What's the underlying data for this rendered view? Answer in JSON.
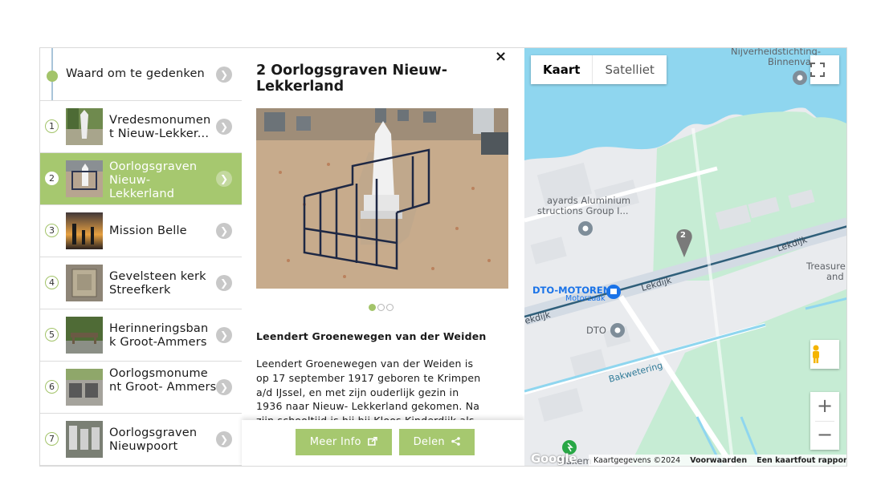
{
  "sidebar": {
    "header_label": "Waard om te gedenken",
    "items": [
      {
        "number": "1",
        "label": "Vredesmonumen t Nieuw-Lekker..."
      },
      {
        "number": "2",
        "label": "Oorlogsgraven Nieuw- Lekkerland"
      },
      {
        "number": "3",
        "label": "Mission Belle"
      },
      {
        "number": "4",
        "label": "Gevelsteen kerk Streefkerk"
      },
      {
        "number": "5",
        "label": "Herinneringsban k Groot-Ammers"
      },
      {
        "number": "6",
        "label": "Oorlogsmonume nt Groot- Ammers"
      },
      {
        "number": "7",
        "label": "Oorlogsgraven Nieuwpoort"
      }
    ],
    "chevron_icon": "chevron-right-icon"
  },
  "detail": {
    "close": "×",
    "title": "2 Oorlogsgraven Nieuw-Lekkerland",
    "carousel": {
      "total": 3,
      "active": 1
    },
    "subheading": "Leendert Groenewegen van der Weiden",
    "body": "Leendert Groenewegen van der Weiden is op 17 september 1917 geboren te Krimpen a/d IJssel, en met zijn ouderlijk gezin in 1936 naar Nieuw- Lekkerland gekomen. Na zijn schooltijd is hij bij Kloos Kinderdijk als",
    "more_info_label": "Meer Info",
    "share_label": "Delen"
  },
  "map": {
    "type_map": "Kaart",
    "type_satellite": "Satelliet",
    "labels": {
      "nijverheid": "Nijverheidstichting-",
      "binnenvaart": "Binnenvaart",
      "layards1": "ayards Aluminium",
      "layards2": "structions Group I...",
      "treasure1": "Treasure",
      "treasure2": "and",
      "dto_motoren": "DTO-MOTOREN",
      "motorzaak": "Motorzaak",
      "dto": "DTO",
      "lekdijk1": "Lekdijk",
      "lekdijk2": "Lekdijk",
      "lekdijk3": "ekdijk",
      "bakwetering": "Bakwetering",
      "maxem": "Maxem"
    },
    "marker_number": "2",
    "footer": {
      "data": "Kaartgegevens ©2024",
      "terms": "Voorwaarden",
      "report": "Een kaartfout rapporteren"
    },
    "logo": "Google",
    "zoom_in": "+",
    "zoom_out": "−",
    "colors": {
      "water": "#8fd6ef",
      "green": "#c6ecd4",
      "land": "#e9ebee",
      "road": "#c9d3dc",
      "accent": "#a6c86f"
    }
  }
}
